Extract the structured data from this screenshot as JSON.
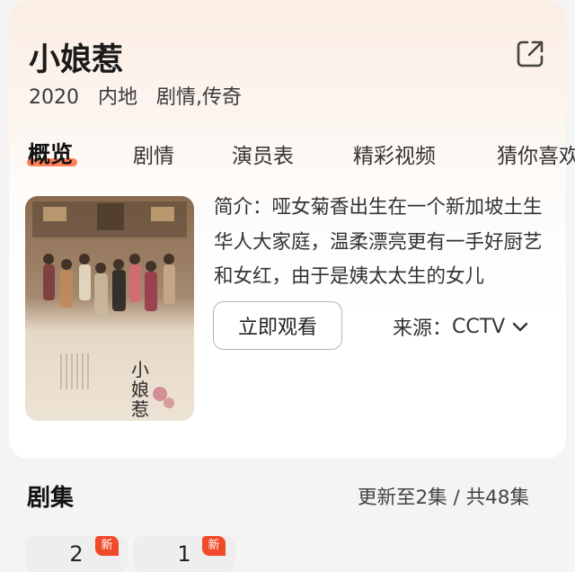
{
  "detail": {
    "title": "小娘惹",
    "year": "2020",
    "region": "内地",
    "genres": "剧情,传奇"
  },
  "tabs": [
    {
      "label": "概览",
      "active": true
    },
    {
      "label": "剧情",
      "active": false
    },
    {
      "label": "演员表",
      "active": false
    },
    {
      "label": "精彩视频",
      "active": false
    },
    {
      "label": "猜你喜欢",
      "active": false
    }
  ],
  "overview": {
    "synopsis": "简介：哑女菊香出生在一个新加坡土生华人大家庭，温柔漂亮更有一手好厨艺和女红，由于是姨太太生的女儿",
    "watch_label": "立即观看",
    "source_prefix": "来源：",
    "source_value": "CCTV"
  },
  "episodes": {
    "title": "剧集",
    "info": "更新至2集 / 共48集",
    "items": [
      {
        "number": "2",
        "badge": "新"
      },
      {
        "number": "1",
        "badge": "新"
      }
    ]
  },
  "colors": {
    "accent": "#ff6a3d",
    "badge": "#f04a2a"
  }
}
